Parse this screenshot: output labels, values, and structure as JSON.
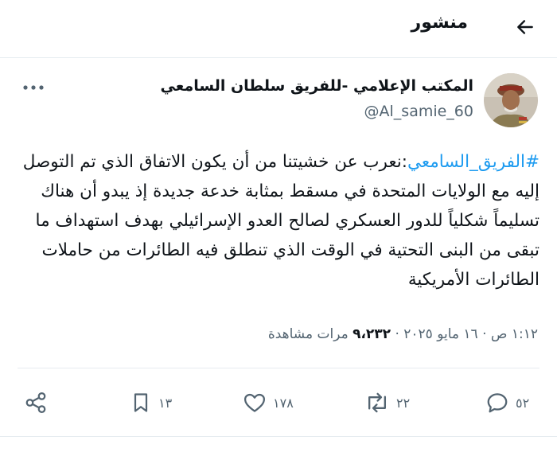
{
  "header": {
    "title": "منشور"
  },
  "author": {
    "display_name": "المكتب الإعلامي -للفريق سلطان السامعي",
    "handle": "@Al_samie_60"
  },
  "tweet": {
    "hashtag": "#الفريق_السامعي",
    "text": ":نعرب عن خشيتنا من أن يكون الاتفاق الذي تم التوصل إليه مع الولايات المتحدة في مسقط بمثابة خدعة جديدة إذ يبدو أن هناك تسليماً شكلياً للدور العسكري لصالح العدو الإسرائيلي بهدف استهداف ما تبقى من البنى التحتية في الوقت الذي تنطلق فيه الطائرات من حاملات الطائرات الأمريكية"
  },
  "meta": {
    "time": "١:١٢ ص",
    "separator": "·",
    "date": "١٦ مايو ٢٠٢٥",
    "views_count": "٩،٢٣٢",
    "views_label": "مرات مشاهدة"
  },
  "actions": {
    "replies": "٥٢",
    "reposts": "٢٢",
    "likes": "١٧٨",
    "bookmarks": "١٣"
  },
  "colors": {
    "hashtag": "#1d9bf0",
    "secondary_text": "#536471",
    "primary_text": "#0f1419",
    "divider": "#e6ecf0"
  }
}
